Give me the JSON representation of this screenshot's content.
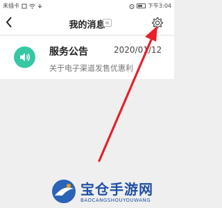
{
  "status_bar": {
    "carrier": "未插卡",
    "icons": [
      "sim-icon",
      "wifi-icon",
      "download-icon"
    ],
    "time": "下午3:04",
    "right_icons": [
      "alarm-icon",
      "battery-icon"
    ]
  },
  "header": {
    "back_icon": "chevron-left-icon",
    "title": "我的消息",
    "title_icon": "message-box-icon",
    "settings_icon": "gear-icon"
  },
  "messages": [
    {
      "icon": "speaker-icon",
      "icon_color": "#37c7a3",
      "title": "服务公告",
      "date": "2020/01/12",
      "preview": "关于电子渠道发售优惠利"
    }
  ],
  "annotation": {
    "arrow_color": "#e8202a",
    "points_to": "gear-icon"
  },
  "watermark": {
    "title": "宝仓手游网",
    "subtitle": "BAOCANGSHOUYOUWANG"
  }
}
